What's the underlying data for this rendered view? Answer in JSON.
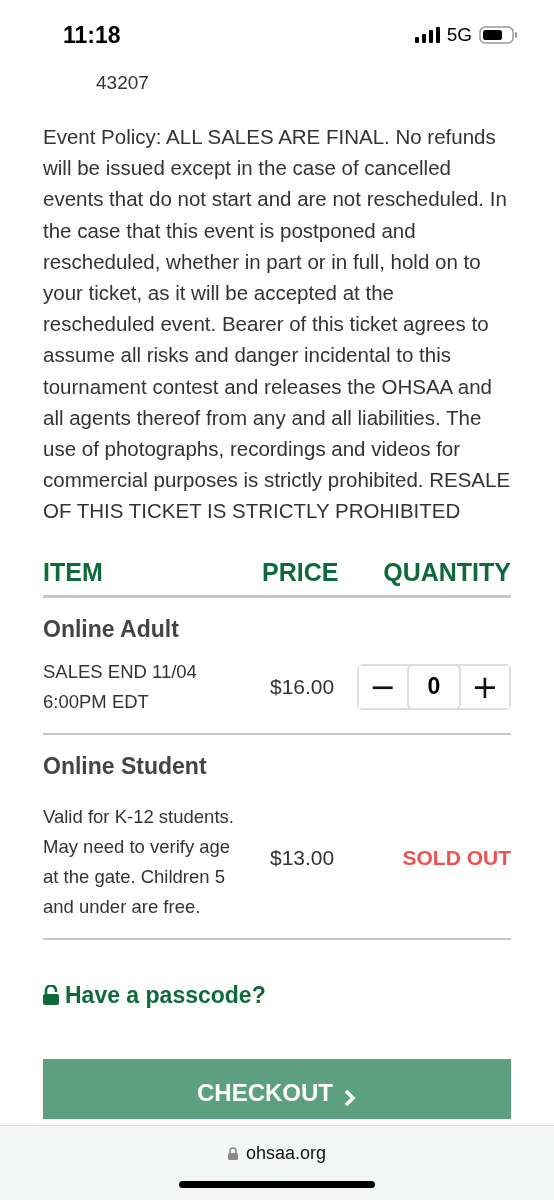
{
  "status_bar": {
    "time": "11:18",
    "network": "5G"
  },
  "address_line": "43207",
  "policy": "Event Policy: ALL SALES ARE FINAL. No refunds will be issued except in the case of cancelled events that do not start and are not rescheduled. In the case that this event is postponed and rescheduled, whether in part or in full, hold on to your ticket, as it will be accepted at the rescheduled event. Bearer of this ticket agrees to assume all risks and danger incidental to this tournament contest and releases the OHSAA and all agents thereof from any and all liabilities. The use of photographs, recordings and videos for commercial purposes is strictly prohibited. RESALE OF THIS TICKET IS STRICTLY PROHIBITED",
  "table": {
    "columns": [
      "ITEM",
      "PRICE",
      "QUANTITY"
    ],
    "rows": [
      {
        "name": "Online Adult",
        "note": "SALES END 11/04 6:00PM EDT",
        "price": "$16.00",
        "kind": "stepper",
        "minus": "−",
        "quantity": "0",
        "plus": "+"
      },
      {
        "name": "Online Student",
        "note": "Valid for K-12 students. May need to verify age at the gate. Children 5 and under are free.",
        "price": "$13.00",
        "kind": "sold_out",
        "status": "SOLD OUT"
      }
    ]
  },
  "passcode_link": "Have a passcode?",
  "checkout_button": "CHECKOUT",
  "browser_bar": {
    "url": "ohsaa.org"
  }
}
